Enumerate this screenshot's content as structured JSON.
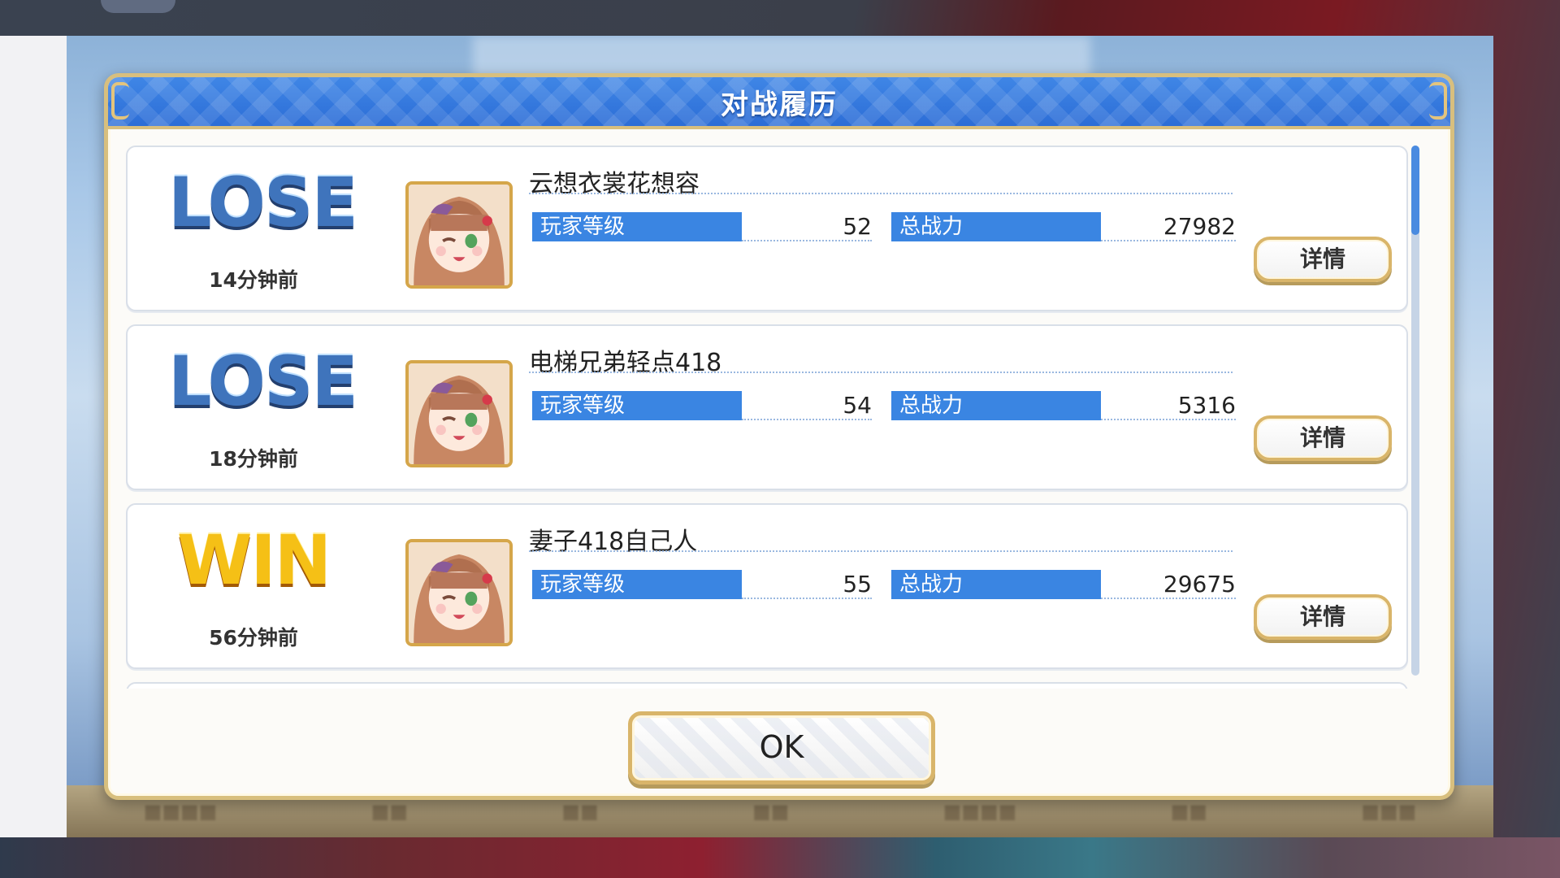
{
  "dialog": {
    "title": "对战履历",
    "ok_label": "OK"
  },
  "labels": {
    "level": "玩家等级",
    "power": "总战力",
    "details": "详情"
  },
  "matches": [
    {
      "result": "LOSE",
      "time_ago": "14分钟前",
      "player_name": "云想衣裳花想容",
      "level": "52",
      "power": "27982"
    },
    {
      "result": "LOSE",
      "time_ago": "18分钟前",
      "player_name": "电梯兄弟轻点418",
      "level": "54",
      "power": "5316"
    },
    {
      "result": "WIN",
      "time_ago": "56分钟前",
      "player_name": "妻子418自己人",
      "level": "55",
      "power": "29675"
    }
  ],
  "colors": {
    "header_blue": "#2c6dd6",
    "stat_bar_blue": "#3a85e2",
    "gold_border": "#d8bf7e",
    "lose_blue": "#3f74bc",
    "win_gold": "#f5c016"
  },
  "icons": {
    "avatar": "character-portrait-icon"
  }
}
